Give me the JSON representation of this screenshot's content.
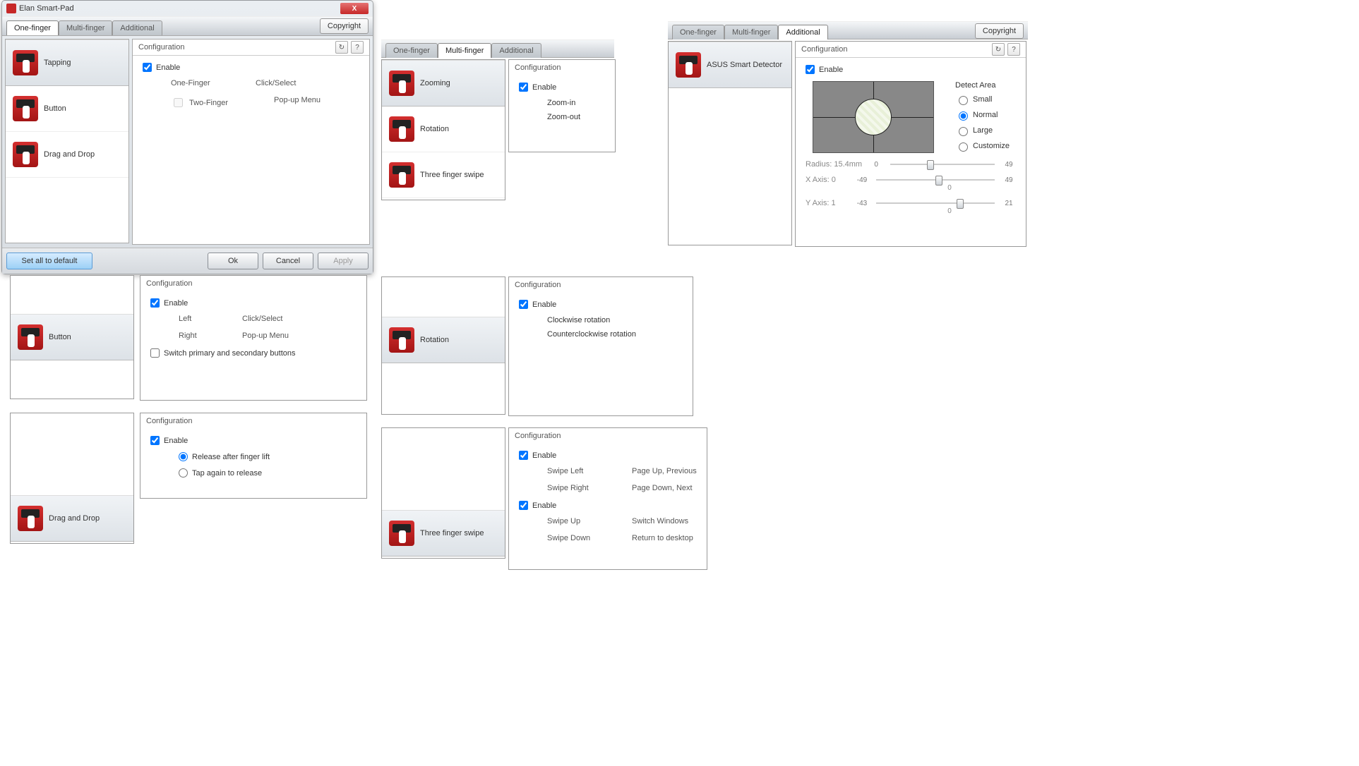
{
  "window_title": "Elan Smart-Pad",
  "tabs": [
    "One-finger",
    "Multi-finger",
    "Additional"
  ],
  "copyright_btn": "Copyright",
  "buttons": {
    "set_default": "Set all to default",
    "ok": "Ok",
    "cancel": "Cancel",
    "apply": "Apply"
  },
  "config_header": "Configuration",
  "enable": "Enable",
  "window1": {
    "active_tab": 0,
    "sidebar": [
      "Tapping",
      "Button",
      "Drag and Drop"
    ],
    "selected": 0,
    "rows": [
      {
        "l": "One-Finger",
        "r": "Click/Select",
        "muted": false
      },
      {
        "l": "Two-Finger",
        "r": "Pop-up Menu",
        "muted": true
      }
    ]
  },
  "window2": {
    "active_tab": 1,
    "sidebar": [
      "Zooming",
      "Rotation",
      "Three finger swipe"
    ],
    "selected": 0,
    "items": [
      "Zoom-in",
      "Zoom-out"
    ]
  },
  "window3": {
    "active_tab": 2,
    "sidebar": [
      "ASUS Smart Detector"
    ],
    "detect_label": "Detect Area",
    "detect_options": [
      "Small",
      "Normal",
      "Large",
      "Customize"
    ],
    "detect_selected": 1,
    "sliders": {
      "radius": {
        "label": "Radius:",
        "value": "15.4mm",
        "min": "0",
        "max": "49",
        "pos": 35
      },
      "xaxis": {
        "label": "X Axis:",
        "value": "0",
        "min": "-49",
        "max": "49",
        "pos": 50,
        "center": "0"
      },
      "yaxis": {
        "label": "Y Axis:",
        "value": "1",
        "min": "-43",
        "max": "21",
        "pos": 68,
        "center": "0"
      }
    }
  },
  "panel_button": {
    "sidebar": [
      "Button"
    ],
    "rows": [
      {
        "l": "Left",
        "r": "Click/Select"
      },
      {
        "l": "Right",
        "r": "Pop-up Menu"
      }
    ],
    "swap": "Switch primary and secondary buttons"
  },
  "panel_drag": {
    "sidebar": [
      "Drag and Drop"
    ],
    "radios": [
      "Release after finger lift",
      "Tap again to release"
    ],
    "selected": 0
  },
  "panel_rotation": {
    "sidebar": [
      "Rotation"
    ],
    "items": [
      "Clockwise rotation",
      "Counterclockwise rotation"
    ]
  },
  "panel_threeswipe": {
    "sidebar": [
      "Three finger swipe"
    ],
    "blocks": [
      {
        "enable": true,
        "rows": [
          {
            "l": "Swipe Left",
            "r": "Page Up, Previous"
          },
          {
            "l": "Swipe Right",
            "r": "Page Down, Next"
          }
        ]
      },
      {
        "enable": true,
        "rows": [
          {
            "l": "Swipe Up",
            "r": "Switch Windows"
          },
          {
            "l": "Swipe Down",
            "r": "Return to desktop"
          }
        ]
      }
    ]
  }
}
